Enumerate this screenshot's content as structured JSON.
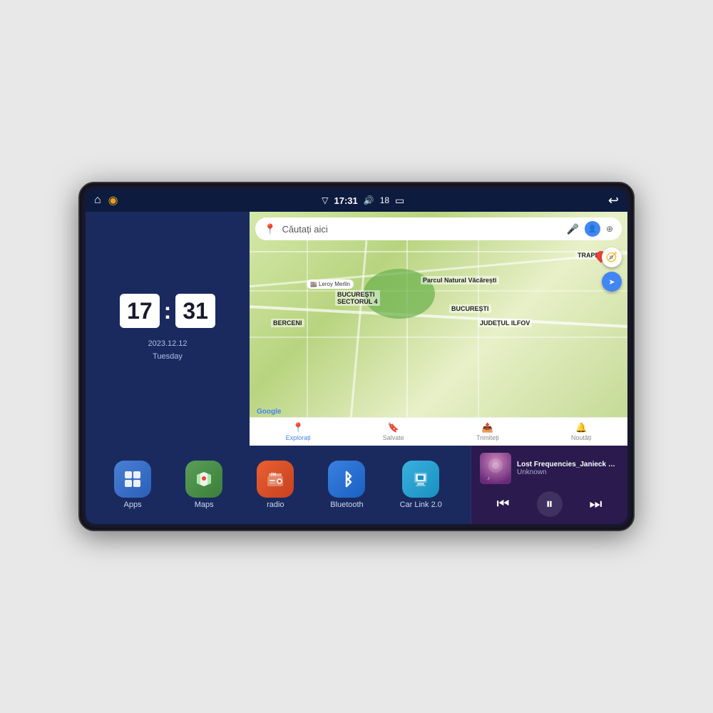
{
  "device": {
    "status_bar": {
      "left_icons": [
        "home",
        "maps"
      ],
      "time": "17:31",
      "signal_icon": "▾",
      "volume_icon": "🔊",
      "battery_level": "18",
      "battery_icon": "🔋",
      "back_icon": "↩"
    },
    "clock_widget": {
      "hours": "17",
      "minutes": "31",
      "date": "2023.12.12",
      "day": "Tuesday"
    },
    "map_widget": {
      "search_placeholder": "Căutați aici",
      "nav_items": [
        {
          "label": "Explorați",
          "icon": "📍",
          "active": true
        },
        {
          "label": "Salvate",
          "icon": "🔖",
          "active": false
        },
        {
          "label": "Trimiteți",
          "icon": "📤",
          "active": false
        },
        {
          "label": "Noutăți",
          "icon": "🔔",
          "active": false
        }
      ],
      "map_labels": [
        "BUCUREȘTI",
        "JUDEȚUL ILFOV",
        "TRAPEZULUI",
        "BERCENI",
        "Parcul Natural Văcărești",
        "Leroy Merlin",
        "BUCUREȘTI SECTORUL 4"
      ]
    },
    "app_icons": [
      {
        "id": "apps",
        "label": "Apps",
        "icon": "⊞",
        "color_class": "icon-apps"
      },
      {
        "id": "maps",
        "label": "Maps",
        "icon": "📍",
        "color_class": "icon-maps"
      },
      {
        "id": "radio",
        "label": "radio",
        "icon": "📻",
        "color_class": "icon-radio"
      },
      {
        "id": "bluetooth",
        "label": "Bluetooth",
        "icon": "⛛",
        "color_class": "icon-bluetooth"
      },
      {
        "id": "carlink",
        "label": "Car Link 2.0",
        "icon": "📱",
        "color_class": "icon-carlink"
      }
    ],
    "music_player": {
      "title": "Lost Frequencies_Janieck Devy-...",
      "artist": "Unknown",
      "prev_label": "⏮",
      "play_label": "⏸",
      "next_label": "⏭"
    }
  }
}
